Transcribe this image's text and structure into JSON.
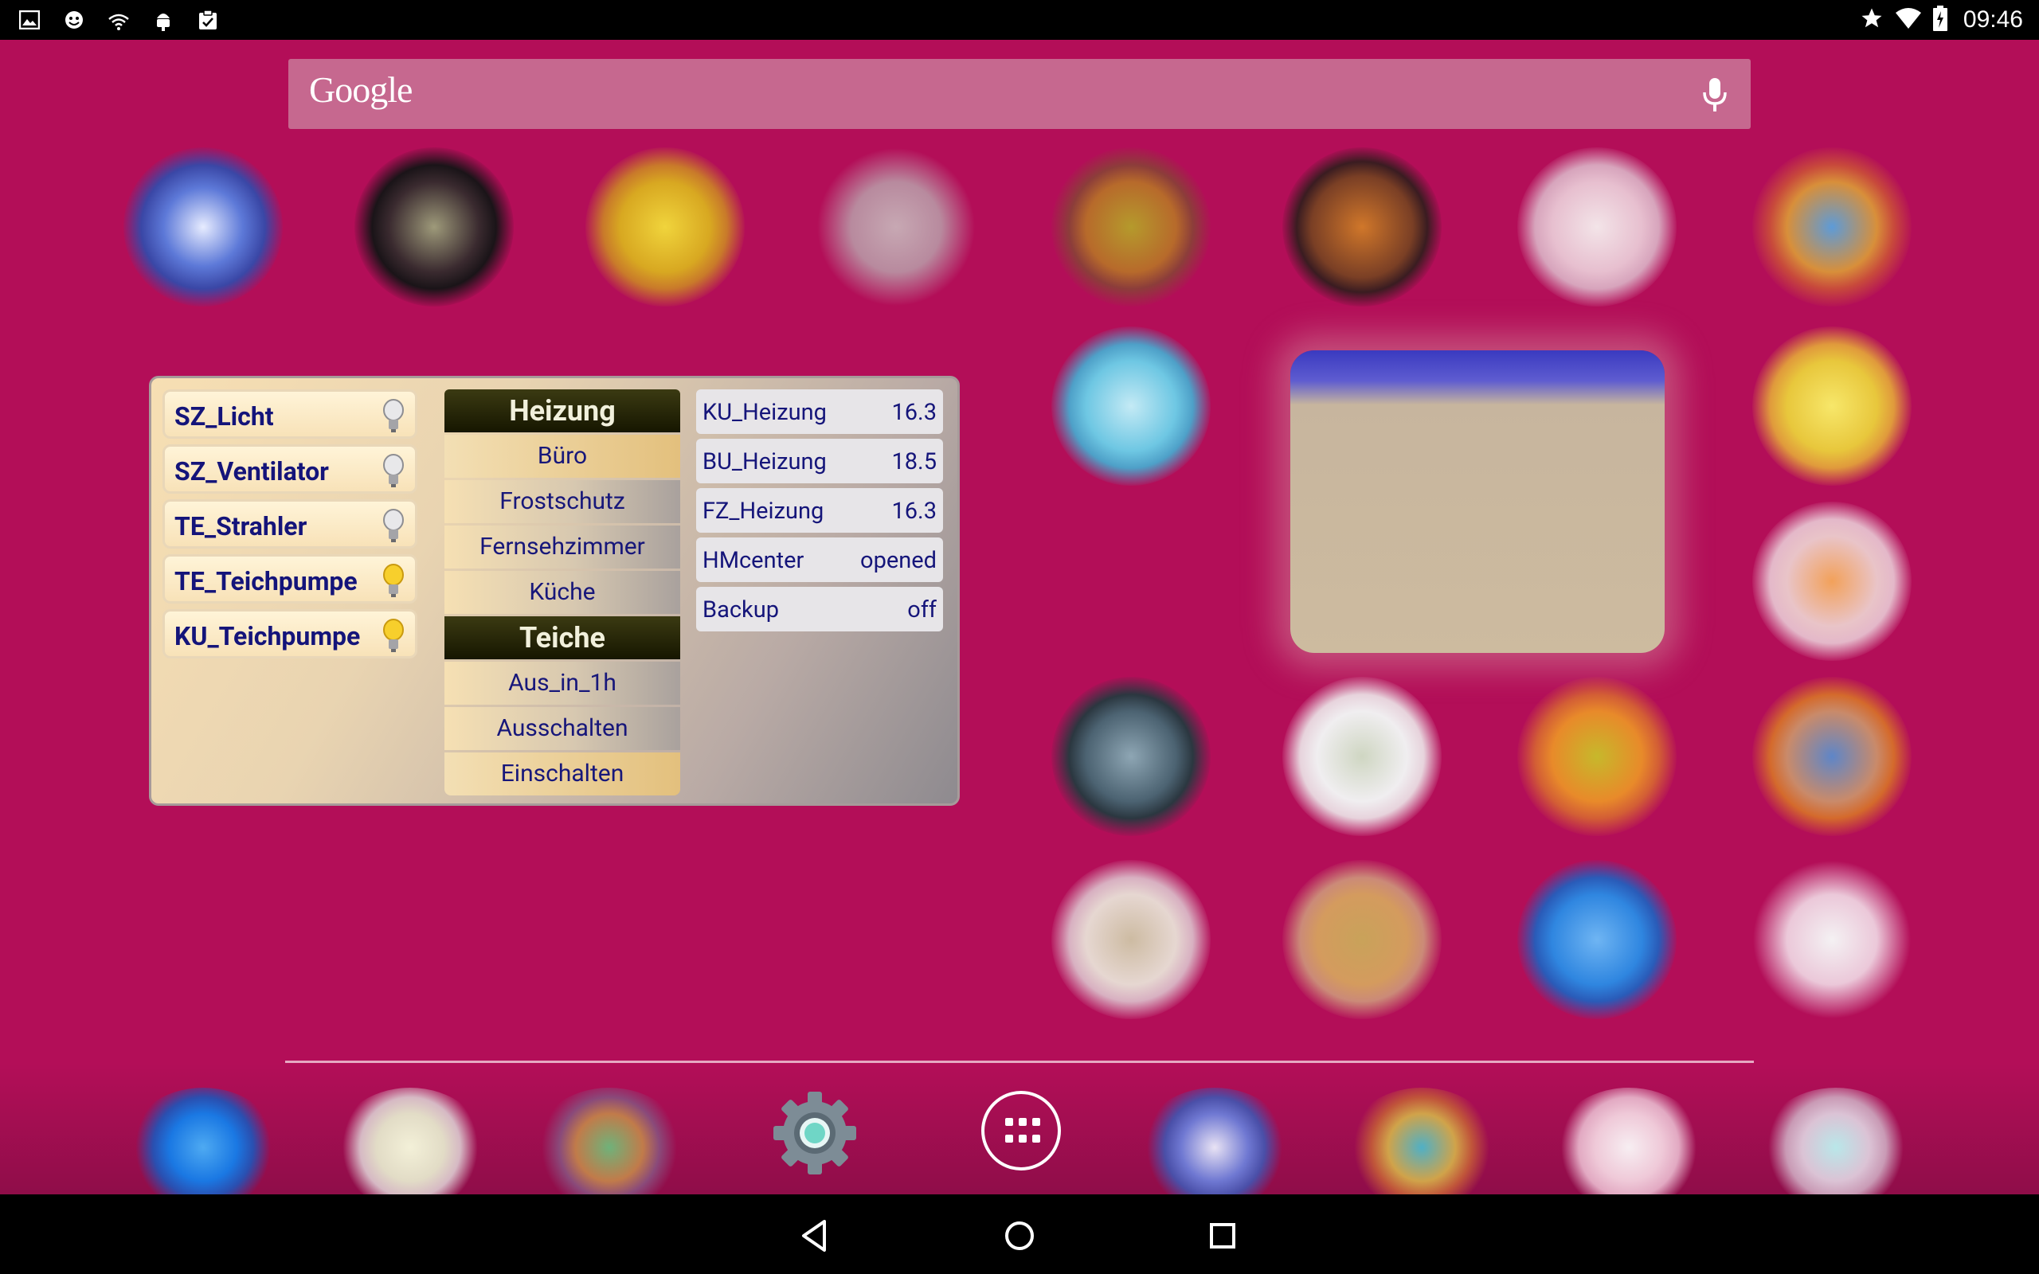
{
  "status_bar": {
    "left_icons": [
      "image-icon",
      "smiley-icon",
      "fritz-wifi-icon",
      "android-debug-icon",
      "clipboard-icon"
    ],
    "right_icons": [
      "star-icon",
      "wifi-icon",
      "battery-icon"
    ],
    "time": "09:46"
  },
  "search": {
    "brand": "Google",
    "mic_icon": "mic-icon"
  },
  "widget": {
    "switches": [
      {
        "label": "SZ_Licht",
        "bulb": "off"
      },
      {
        "label": "SZ_Ventilator",
        "bulb": "off"
      },
      {
        "label": "TE_Strahler",
        "bulb": "off"
      },
      {
        "label": "TE_Teichpumpe",
        "bulb": "on"
      },
      {
        "label": "KU_Teichpumpe",
        "bulb": "on"
      }
    ],
    "heizung": {
      "title": "Heizung",
      "items": [
        "Büro",
        "Frostschutz",
        "Fernsehzimmer",
        "Küche"
      ]
    },
    "teiche": {
      "title": "Teiche",
      "items": [
        "Aus_in_1h",
        "Ausschalten",
        "Einschalten"
      ]
    },
    "values": [
      {
        "name": "KU_Heizung",
        "value": "16.3"
      },
      {
        "name": "BU_Heizung",
        "value": "18.5"
      },
      {
        "name": "FZ_Heizung",
        "value": "16.3"
      },
      {
        "name": "HMcenter",
        "value": "opened"
      },
      {
        "name": "Backup",
        "value": "off"
      }
    ]
  },
  "dock": {
    "settings_icon": "settings-gear-icon",
    "all_apps_icon": "app-drawer-icon"
  },
  "nav": {
    "back": "back-icon",
    "home": "home-icon",
    "recents": "recents-icon"
  },
  "colors": {
    "wallpaper": "#b30e58",
    "bar": "#000000",
    "widget_text": "#14147a"
  }
}
